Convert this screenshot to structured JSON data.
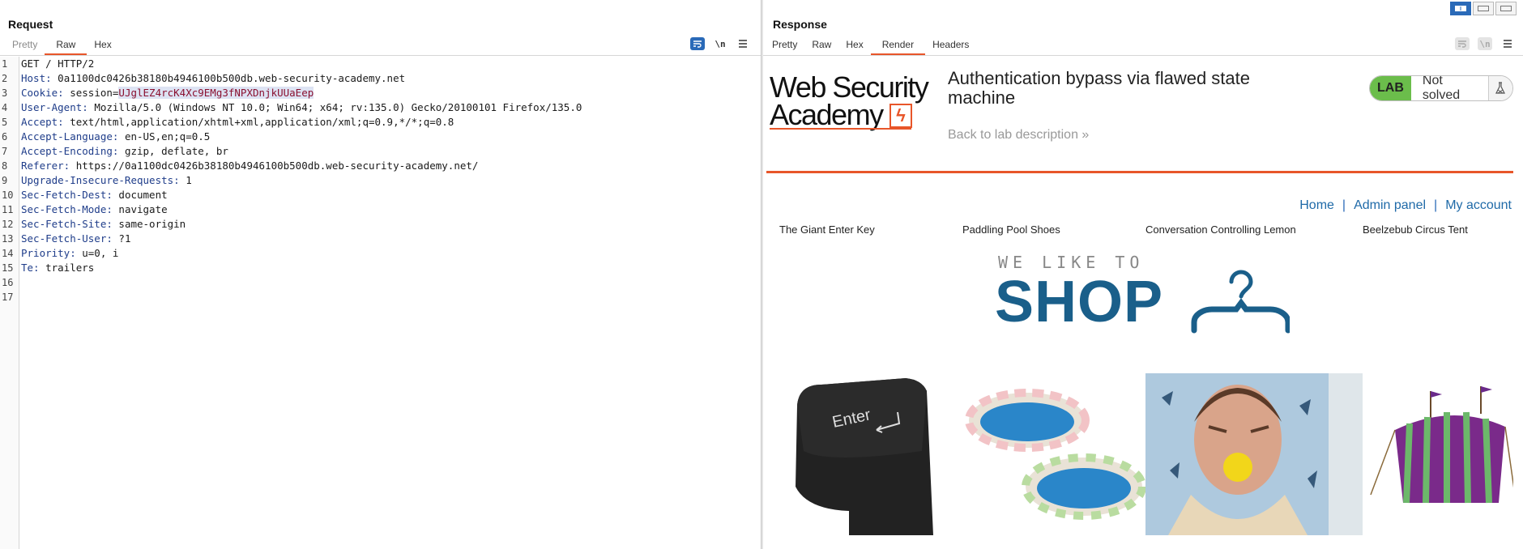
{
  "request": {
    "title": "Request",
    "tabs": [
      "Pretty",
      "Raw",
      "Hex"
    ],
    "active_tab": "Raw",
    "lines": [
      {
        "n": "1",
        "key": "",
        "val": "GET / HTTP/2"
      },
      {
        "n": "2",
        "key": "Host:",
        "val": " 0a1100dc0426b38180b4946100b500db.web-security-academy.net"
      },
      {
        "n": "3",
        "key": "Cookie:",
        "val": " session=",
        "cookie": "UJglEZ4rcK4Xc9EMg3fNPXDnjkUUaEep"
      },
      {
        "n": "4",
        "key": "User-Agent:",
        "val": " Mozilla/5.0 (Windows NT 10.0; Win64; x64; rv:135.0) Gecko/20100101 Firefox/135.0"
      },
      {
        "n": "5",
        "key": "Accept:",
        "val": " text/html,application/xhtml+xml,application/xml;q=0.9,*/*;q=0.8"
      },
      {
        "n": "6",
        "key": "Accept-Language:",
        "val": " en-US,en;q=0.5"
      },
      {
        "n": "7",
        "key": "Accept-Encoding:",
        "val": " gzip, deflate, br"
      },
      {
        "n": "8",
        "key": "Referer:",
        "val": " https://0a1100dc0426b38180b4946100b500db.web-security-academy.net/"
      },
      {
        "n": "9",
        "key": "Upgrade-Insecure-Requests:",
        "val": " 1"
      },
      {
        "n": "10",
        "key": "Sec-Fetch-Dest:",
        "val": " document"
      },
      {
        "n": "11",
        "key": "Sec-Fetch-Mode:",
        "val": " navigate"
      },
      {
        "n": "12",
        "key": "Sec-Fetch-Site:",
        "val": " same-origin"
      },
      {
        "n": "13",
        "key": "Sec-Fetch-User:",
        "val": " ?1"
      },
      {
        "n": "14",
        "key": "Priority:",
        "val": " u=0, i"
      },
      {
        "n": "15",
        "key": "Te:",
        "val": " trailers"
      },
      {
        "n": "16",
        "key": "",
        "val": ""
      },
      {
        "n": "17",
        "key": "",
        "val": ""
      }
    ],
    "icons": [
      "wrap-icon",
      "newline-icon",
      "menu-icon"
    ]
  },
  "response": {
    "title": "Response",
    "tabs": [
      "Pretty",
      "Raw",
      "Hex",
      "Render",
      "Headers"
    ],
    "active_tab": "Render",
    "render": {
      "logo_line1": "Web Security",
      "logo_line2": "Academy",
      "logo_bolt": "ϟ",
      "lab_title": "Authentication bypass via flawed state machine",
      "back_link": "Back to lab description »",
      "lab_badge": "LAB",
      "lab_status": "Not solved",
      "lab_icon": "flask-icon",
      "nav": {
        "home": "Home",
        "sep": "|",
        "admin": "Admin panel",
        "account": "My account"
      },
      "shop_tagline": "WE LIKE TO",
      "shop_word": "SHOP",
      "products": [
        {
          "name": "The Giant Enter Key",
          "image": "giant-enter-key",
          "key_text": "Enter"
        },
        {
          "name": "Paddling Pool Shoes",
          "image": "paddling-pools"
        },
        {
          "name": "Conversation Controlling Lemon",
          "image": "man-biting-lemon"
        },
        {
          "name": "Beelzebub Circus Tent",
          "image": "circus-tent"
        }
      ]
    }
  },
  "colors": {
    "accent": "#e8562a",
    "link": "#1f6aa8",
    "lab_green": "#6bbd4b",
    "shop_blue": "#1a5f8a",
    "header_key": "#1f3d8a",
    "cookie": "#8a1030"
  }
}
